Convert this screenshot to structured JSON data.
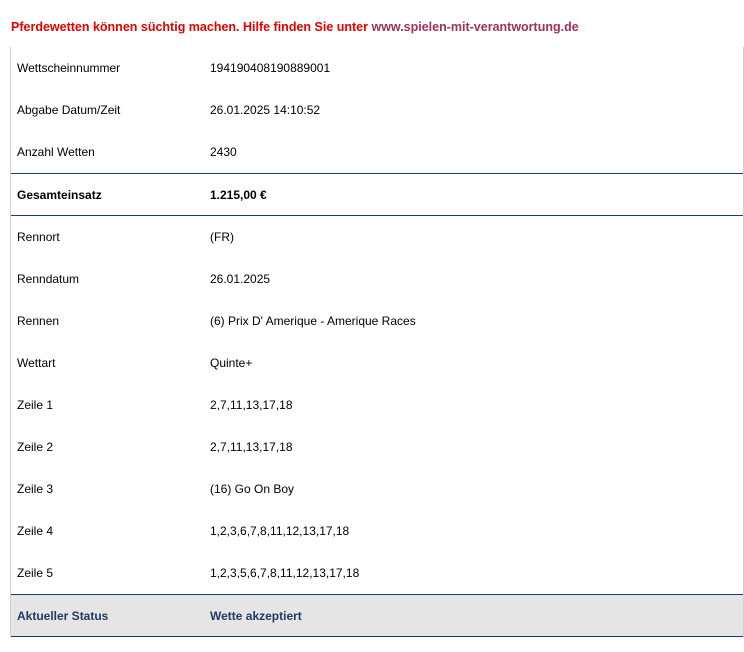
{
  "warning": {
    "text": "Pferdewetten können süchtig machen. Hilfe finden Sie unter ",
    "link": "www.spielen-mit-verantwortung.de"
  },
  "ticket": {
    "header_rows": [
      {
        "label": "Wettscheinnummer",
        "value": "194190408190889001"
      },
      {
        "label": "Abgabe Datum/Zeit",
        "value": "26.01.2025 14:10:52"
      },
      {
        "label": "Anzahl Wetten",
        "value": "2430"
      }
    ],
    "total": {
      "label": "Gesamteinsatz",
      "value": "1.215,00 €"
    },
    "detail_rows": [
      {
        "label": "Rennort",
        "value": "(FR)"
      },
      {
        "label": "Renndatum",
        "value": "26.01.2025"
      },
      {
        "label": "Rennen",
        "value": "(6) Prix D' Amerique - Amerique Races"
      },
      {
        "label": "Wettart",
        "value": "Quinte+"
      },
      {
        "label": "Zeile 1",
        "value": "2,7,11,13,17,18"
      },
      {
        "label": "Zeile 2",
        "value": "2,7,11,13,17,18"
      },
      {
        "label": "Zeile 3",
        "value": "(16) Go On Boy"
      },
      {
        "label": "Zeile 4",
        "value": "1,2,3,6,7,8,11,12,13,17,18"
      },
      {
        "label": "Zeile 5",
        "value": "1,2,3,5,6,7,8,11,12,13,17,18"
      }
    ],
    "status": {
      "label": "Aktueller Status",
      "value": "Wette akzeptiert"
    }
  },
  "colors": {
    "warning_text": "#e60000",
    "link": "#a0305a",
    "navy": "#1f3a68",
    "status_bg": "#e5e5e5"
  }
}
